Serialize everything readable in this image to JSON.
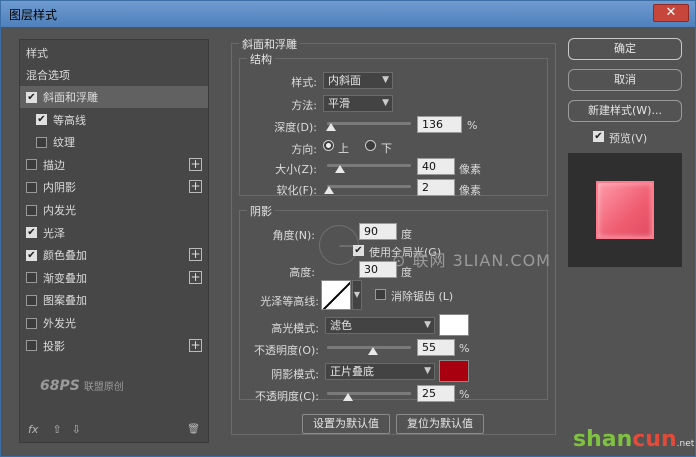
{
  "window": {
    "title": "图层样式",
    "close": "✕"
  },
  "sidebar": {
    "header": "样式",
    "blend_options": "混合选项",
    "items": [
      {
        "label": "斜面和浮雕",
        "checked": true,
        "selected": true,
        "plus": false
      },
      {
        "label": "等高线",
        "checked": true,
        "sub": true,
        "plus": false
      },
      {
        "label": "纹理",
        "checked": false,
        "sub": true,
        "plus": false
      },
      {
        "label": "描边",
        "checked": false,
        "plus": true
      },
      {
        "label": "内阴影",
        "checked": false,
        "plus": true
      },
      {
        "label": "内发光",
        "checked": false,
        "plus": false
      },
      {
        "label": "光泽",
        "checked": true,
        "plus": false
      },
      {
        "label": "颜色叠加",
        "checked": true,
        "plus": true
      },
      {
        "label": "渐变叠加",
        "checked": false,
        "plus": true
      },
      {
        "label": "图案叠加",
        "checked": false,
        "plus": false
      },
      {
        "label": "外发光",
        "checked": false,
        "plus": false
      },
      {
        "label": "投影",
        "checked": false,
        "plus": true
      }
    ],
    "watermark_main": "68PS",
    "watermark_sub": "联盟原创",
    "footer": {
      "fx": "fx",
      "up": "⇧",
      "down": "⇩",
      "trash": "🗑"
    }
  },
  "bevel": {
    "group_title": "斜面和浮雕",
    "structure_title": "结构",
    "style_label": "样式:",
    "style_value": "内斜面",
    "technique_label": "方法:",
    "technique_value": "平滑",
    "depth_label": "深度(D):",
    "depth_value": "136",
    "depth_unit": "%",
    "depth_level": 0.05,
    "direction_label": "方向:",
    "dir_up": "上",
    "dir_down": "下",
    "size_label": "大小(Z):",
    "size_value": "40",
    "size_unit": "像素",
    "size_level": 0.16,
    "soften_label": "软化(F):",
    "soften_value": "2",
    "soften_unit": "像素",
    "soften_level": 0.02
  },
  "shading": {
    "title": "阴影",
    "angle_label": "角度(N):",
    "angle_value": "90",
    "angle_unit": "度",
    "global_light_label": "使用全局光(G)",
    "altitude_label": "高度:",
    "altitude_value": "30",
    "altitude_unit": "度",
    "gloss_label": "光泽等高线:",
    "antialias_label": "消除锯齿 (L)",
    "highlight_label": "高光模式:",
    "highlight_mode": "滤色",
    "highlight_color": "#ffffff",
    "highlight_opacity_label": "不透明度(O):",
    "highlight_opacity": "55",
    "highlight_opacity_unit": "%",
    "highlight_level": 0.55,
    "shadow_label": "阴影模式:",
    "shadow_mode": "正片叠底",
    "shadow_color": "#a8000f",
    "shadow_opacity_label": "不透明度(C):",
    "shadow_opacity": "25",
    "shadow_opacity_unit": "%",
    "shadow_level": 0.25
  },
  "buttons": {
    "set_default": "设置为默认值",
    "reset_default": "复位为默认值",
    "ok": "确定",
    "cancel": "取消",
    "new_style": "新建样式(W)...",
    "preview": "预览(V)"
  },
  "watermarks": {
    "lian": "⊙ 联网 3LIAN.COM",
    "shancun1": "shan",
    "shancun2": "cun",
    "shancun_net": ".net"
  }
}
